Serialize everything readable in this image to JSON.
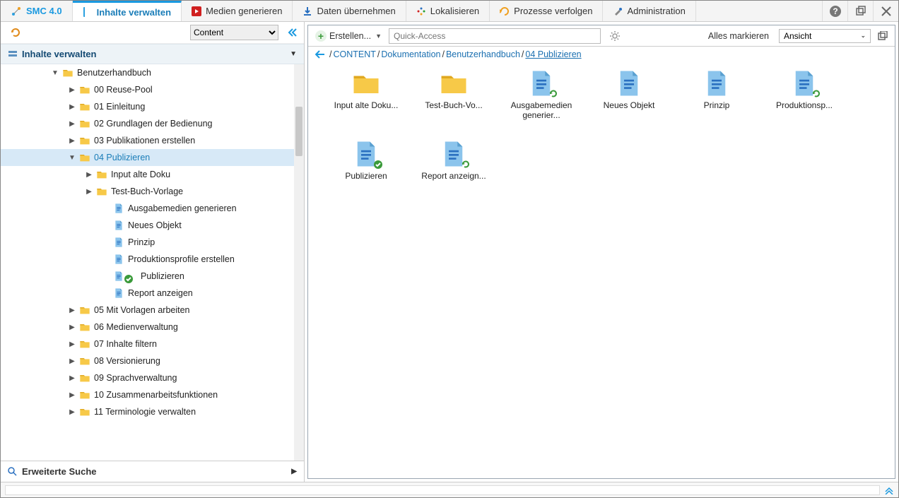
{
  "app": {
    "brand": "SMC 4.0"
  },
  "topmenu": {
    "items": [
      {
        "label": "Inhalte verwalten",
        "active": true,
        "icon": "book"
      },
      {
        "label": "Medien generieren",
        "icon": "play"
      },
      {
        "label": "Daten übernehmen",
        "icon": "download"
      },
      {
        "label": "Lokalisieren",
        "icon": "localize"
      },
      {
        "label": "Prozesse verfolgen",
        "icon": "process"
      },
      {
        "label": "Administration",
        "icon": "tools"
      }
    ]
  },
  "left": {
    "selector": "Content",
    "panel_title": "Inhalte verwalten",
    "adv_search": "Erweiterte Suche",
    "tree": [
      {
        "indent": 72,
        "arrow": "down",
        "type": "folder",
        "label": "Benutzerhandbuch"
      },
      {
        "indent": 96,
        "arrow": "right",
        "type": "folder",
        "label": "00 Reuse-Pool"
      },
      {
        "indent": 96,
        "arrow": "right",
        "type": "folder",
        "label": "01 Einleitung"
      },
      {
        "indent": 96,
        "arrow": "right",
        "type": "folder",
        "label": "02 Grundlagen der Bedienung"
      },
      {
        "indent": 96,
        "arrow": "right",
        "type": "folder",
        "label": "03 Publikationen erstellen"
      },
      {
        "indent": 96,
        "arrow": "down",
        "type": "folder",
        "label": "04 Publizieren",
        "selected": true
      },
      {
        "indent": 120,
        "arrow": "right",
        "type": "folder",
        "label": "Input alte Doku"
      },
      {
        "indent": 120,
        "arrow": "right",
        "type": "folder",
        "label": "Test-Buch-Vorlage"
      },
      {
        "indent": 144,
        "arrow": "",
        "type": "file",
        "label": "Ausgabemedien generieren"
      },
      {
        "indent": 144,
        "arrow": "",
        "type": "file",
        "label": "Neues Objekt"
      },
      {
        "indent": 144,
        "arrow": "",
        "type": "file",
        "label": "Prinzip"
      },
      {
        "indent": 144,
        "arrow": "",
        "type": "file",
        "label": "Produktionsprofile erstellen"
      },
      {
        "indent": 144,
        "arrow": "",
        "type": "file-check",
        "label": "Publizieren"
      },
      {
        "indent": 144,
        "arrow": "",
        "type": "file",
        "label": "Report anzeigen"
      },
      {
        "indent": 96,
        "arrow": "right",
        "type": "folder",
        "label": "05 Mit Vorlagen arbeiten"
      },
      {
        "indent": 96,
        "arrow": "right",
        "type": "folder",
        "label": "06 Medienverwaltung"
      },
      {
        "indent": 96,
        "arrow": "right",
        "type": "folder",
        "label": "07 Inhalte filtern"
      },
      {
        "indent": 96,
        "arrow": "right",
        "type": "folder",
        "label": "08 Versionierung"
      },
      {
        "indent": 96,
        "arrow": "right",
        "type": "folder",
        "label": "09 Sprachverwaltung"
      },
      {
        "indent": 96,
        "arrow": "right",
        "type": "folder",
        "label": "10 Zusammenarbeitsfunktionen"
      },
      {
        "indent": 96,
        "arrow": "right",
        "type": "folder",
        "label": "11 Terminologie verwalten"
      }
    ]
  },
  "right": {
    "create_label": "Erstellen...",
    "quick_placeholder": "Quick-Access",
    "mark_all": "Alles markieren",
    "view_label": "Ansicht",
    "breadcrumb": [
      "CONTENT",
      "Dokumentation",
      "Benutzerhandbuch",
      "04 Publizieren"
    ],
    "items": [
      {
        "type": "folder",
        "label": "Input alte Doku...",
        "badge": ""
      },
      {
        "type": "folder",
        "label": "Test-Buch-Vo...",
        "badge": ""
      },
      {
        "type": "file",
        "label": "Ausgabemedien generier...",
        "badge": "refresh"
      },
      {
        "type": "file",
        "label": "Neues Objekt",
        "badge": ""
      },
      {
        "type": "file",
        "label": "Prinzip",
        "badge": ""
      },
      {
        "type": "file",
        "label": "Produktionsp...",
        "badge": "refresh"
      },
      {
        "type": "file",
        "label": "Publizieren",
        "badge": "check"
      },
      {
        "type": "file",
        "label": "Report anzeign...",
        "badge": "refresh"
      }
    ]
  }
}
